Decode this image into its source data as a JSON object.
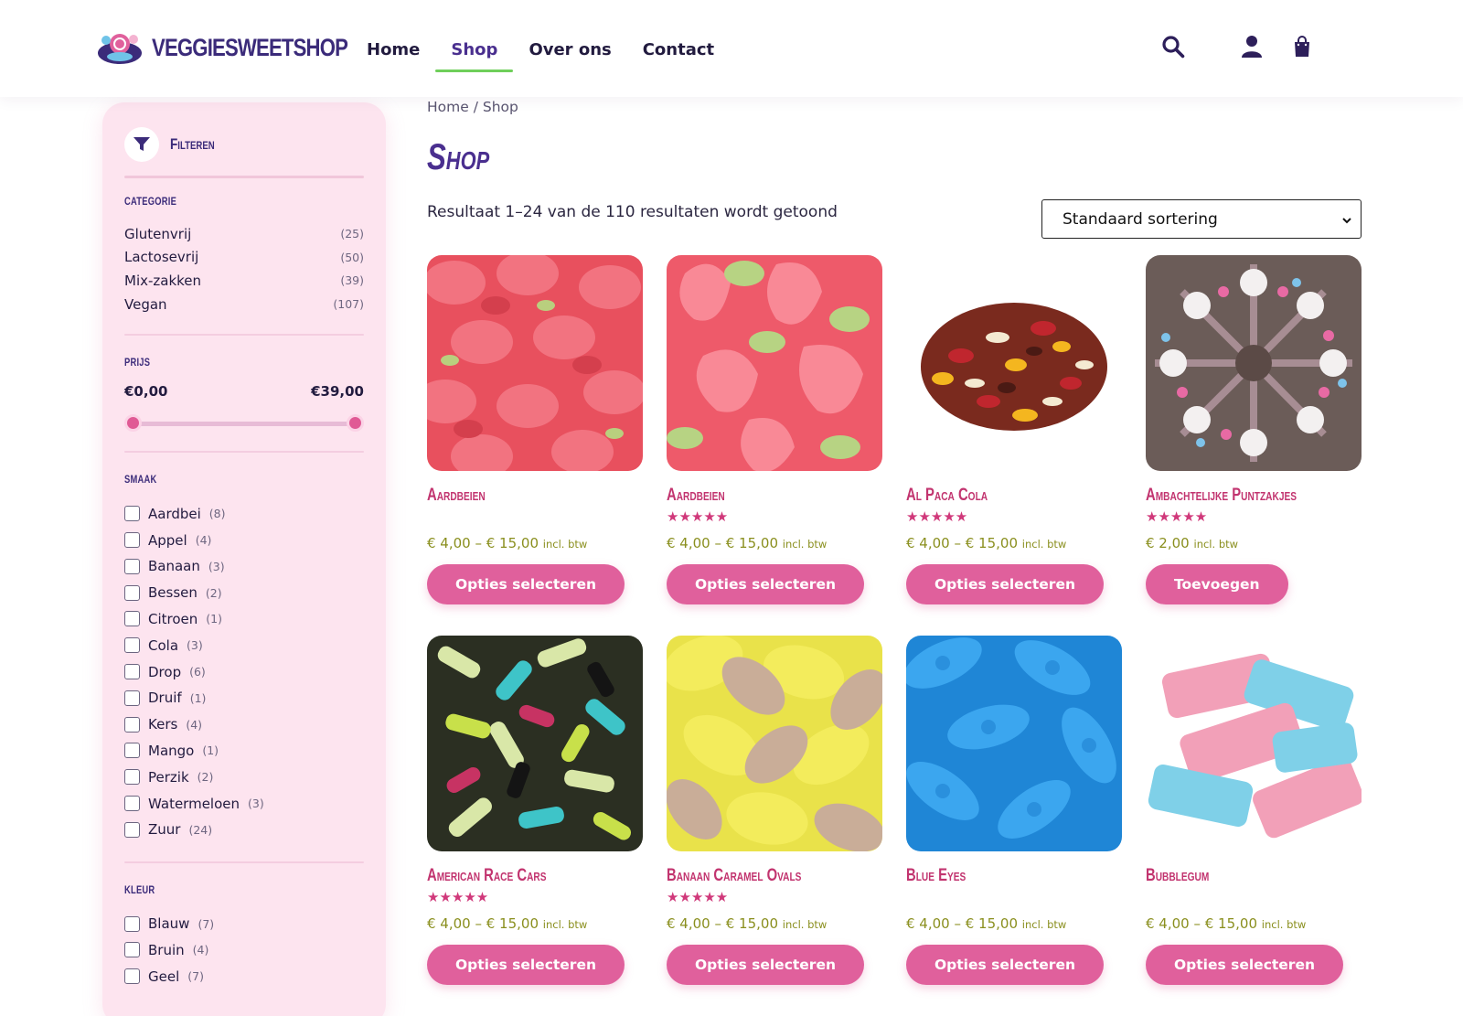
{
  "brand": {
    "name": "VEGGIESWEETSHOP"
  },
  "nav": {
    "items": [
      "Home",
      "Shop",
      "Over ons",
      "Contact"
    ],
    "active": "Shop"
  },
  "header_icons": [
    "search-icon",
    "user-icon",
    "shopping-bag-icon"
  ],
  "colors": {
    "brand_purple": "#4a2f8f",
    "accent_pink": "#e0609c",
    "title_pink": "#c2346f",
    "sidebar_bg": "#fde4ef",
    "active_underline": "#6fcf5a",
    "price_green": "#8a8f1e"
  },
  "sidebar": {
    "title": "Filteren",
    "categorie": {
      "title": "Categorie",
      "items": [
        {
          "label": "Glutenvrij",
          "count": "(25)"
        },
        {
          "label": "Lactosevrij",
          "count": "(50)"
        },
        {
          "label": "Mix-zakken",
          "count": "(39)"
        },
        {
          "label": "Vegan",
          "count": "(107)"
        }
      ]
    },
    "prijs": {
      "title": "Prijs",
      "min": "€0,00",
      "max": "€39,00"
    },
    "smaak": {
      "title": "Smaak",
      "items": [
        {
          "label": "Aardbei",
          "count": "(8)"
        },
        {
          "label": "Appel",
          "count": "(4)"
        },
        {
          "label": "Banaan",
          "count": "(3)"
        },
        {
          "label": "Bessen",
          "count": "(2)"
        },
        {
          "label": "Citroen",
          "count": "(1)"
        },
        {
          "label": "Cola",
          "count": "(3)"
        },
        {
          "label": "Drop",
          "count": "(6)"
        },
        {
          "label": "Druif",
          "count": "(1)"
        },
        {
          "label": "Kers",
          "count": "(4)"
        },
        {
          "label": "Mango",
          "count": "(1)"
        },
        {
          "label": "Perzik",
          "count": "(2)"
        },
        {
          "label": "Watermeloen",
          "count": "(3)"
        },
        {
          "label": "Zuur",
          "count": "(24)"
        }
      ]
    },
    "kleur": {
      "title": "Kleur",
      "items": [
        {
          "label": "Blauw",
          "count": "(7)"
        },
        {
          "label": "Bruin",
          "count": "(4)"
        },
        {
          "label": "Geel",
          "count": "(7)"
        }
      ]
    }
  },
  "main": {
    "breadcrumb": "Home / Shop",
    "title": "Shop",
    "result_count": "Resultaat 1–24 van de 110 resultaten wordt getoond",
    "sort": {
      "selected": "Standaard sortering"
    },
    "products": [
      {
        "name": "Aardbeien",
        "stars": "",
        "price": "€ 4,00 – € 15,00",
        "tax": "incl. btw",
        "button": "Opties selecteren",
        "image": "strawberry-candy-1"
      },
      {
        "name": "Aardbeien",
        "stars": "★★★★★",
        "price": "€ 4,00 – € 15,00",
        "tax": "incl. btw",
        "button": "Opties selecteren",
        "image": "strawberry-candy-2"
      },
      {
        "name": "Al Paca Cola",
        "stars": "★★★★★",
        "price": "€ 4,00 – € 15,00",
        "tax": "incl. btw",
        "button": "Opties selecteren",
        "image": "alpaca-cola-mix"
      },
      {
        "name": "Ambachtelijke Puntzakjes",
        "stars": "★★★★★",
        "price": "€ 2,00",
        "tax": "incl. btw",
        "button": "Toevoegen",
        "image": "candy-cones"
      },
      {
        "name": "American Race Cars",
        "stars": "★★★★★",
        "price": "€ 4,00 – € 15,00",
        "tax": "incl. btw",
        "button": "Opties selecteren",
        "image": "race-cars"
      },
      {
        "name": "Banaan Caramel Ovals",
        "stars": "★★★★★",
        "price": "€ 4,00 – € 15,00",
        "tax": "incl. btw",
        "button": "Opties selecteren",
        "image": "banana-ovals"
      },
      {
        "name": "Blue Eyes",
        "stars": "",
        "price": "€ 4,00 – € 15,00",
        "tax": "incl. btw",
        "button": "Opties selecteren",
        "image": "blue-eyes"
      },
      {
        "name": "Bubblegum",
        "stars": "",
        "price": "€ 4,00 – € 15,00",
        "tax": "incl. btw",
        "button": "Opties selecteren",
        "image": "bubblegum-skum"
      }
    ]
  }
}
